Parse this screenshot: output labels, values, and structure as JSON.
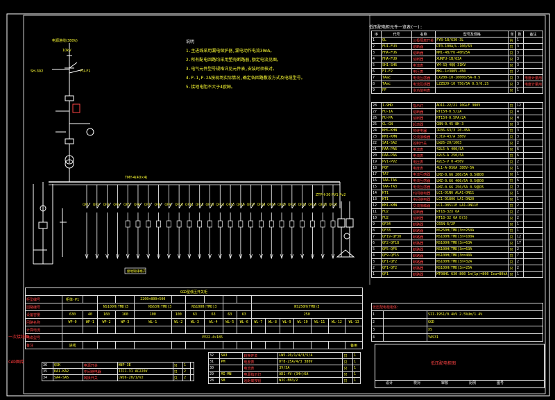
{
  "incoming": {
    "source_label": "电源进线(380V)",
    "voltage": "10kV",
    "switch": "SH-302",
    "fuse_top": "FU-F1",
    "labels": [
      "FH-FU3",
      "TAac",
      "PA",
      "PV",
      "FU3-FU1",
      "PV-PAC",
      "FHA-FU6",
      "HA-FU4",
      "FU-FU6",
      "TH",
      "QF1",
      "CT",
      "GQF1",
      "PM-PAc",
      "MK-1kW",
      "QF1",
      "M-3-7",
      "QF-RL"
    ]
  },
  "bus": {
    "label": "TMY-4(40×4)",
    "right_label": "ZTPH-30 PV1 Pv2",
    "branches": [
      "QF1",
      "QF2",
      "QF3",
      "QF4",
      "QF5",
      "QF6",
      "QF7",
      "QF8",
      "QF9",
      "QF10",
      "QF11",
      "QF12",
      "QF13",
      "QF14",
      "QF15",
      "QF16",
      "QF17",
      "QF18",
      "QF19",
      "QF20",
      "QF21",
      "QF22",
      "QF23",
      "QF24",
      "QF25"
    ],
    "cable_label": "接地铜排端子",
    "aux_labels": [
      "QF33",
      "TA6-TA7",
      "PAN-FHU",
      "SW-TYSN",
      "MLI-IOTB"
    ]
  },
  "notes": {
    "heading": "说明",
    "items": [
      "1.主进线采用漏电保护器,漏电动作电流30mA。",
      "2.所有配电回路均采用塑壳断路器,额定电流见图。",
      "3.电气元件型号规格详见元件表,安装时须核对。",
      "4.P-1,P-2A按现场实际情况,确定各回路敷设方式及电缆型号。",
      "5.接地电阻不大于4欧姆。"
    ]
  },
  "parts": {
    "title": "低压配电柜元件一览表(一):",
    "headers": [
      "序",
      "代号",
      "名称",
      "型号及规格",
      "单",
      "数",
      "备注"
    ],
    "rows": [
      [
        "1",
        "QL",
        "三极隔离开关",
        "FYB-1B/630-3L",
        "台",
        "1",
        ""
      ],
      [
        "2",
        "FU1-FU3",
        "熔断器",
        "RT0-100A/L-100/63",
        "只",
        "3",
        ""
      ],
      [
        "3",
        "FHA-FU6",
        "熔断器",
        "NM1-4B/FU-40H25A",
        "只",
        "3",
        ""
      ],
      [
        "4",
        "FHA-FU9",
        "熔断器",
        "XUNFU-1B/63A",
        "只",
        "3",
        ""
      ],
      [
        "5",
        "SH1-SH6",
        "电流表",
        "YM-SQ-4QQ-31KV",
        "只",
        "3",
        ""
      ],
      [
        "6",
        "F1-F2",
        "电压表",
        "MKL-1×380V-450",
        "只",
        "2",
        ""
      ],
      [
        "7",
        "TAac",
        "电流互感器",
        "LX200-10-10000/5A-0.5",
        "只",
        "3",
        "电度计量用"
      ],
      [
        "8",
        "TAac",
        "电流互感器",
        "LZZBJ9-10 750/5A 0.5/0.2S",
        "只",
        "3",
        "电度计量用"
      ],
      [
        "9",
        "PF",
        "多功能电表",
        "",
        "只",
        "1",
        ""
      ]
    ],
    "rows2": [
      [
        "28",
        "1-9HD",
        "指示灯",
        "AD11-22/21 10GLF 380V",
        "只",
        "12",
        ""
      ],
      [
        "27",
        "FU-1A",
        "熔断器",
        "RT15H-0.5/2A",
        "只",
        "4",
        ""
      ],
      [
        "26",
        "FU-PA",
        "熔断器",
        "RT15H-0.5PA/2A",
        "只",
        "4",
        ""
      ],
      [
        "25",
        "CL-GN",
        "起动器",
        "GBN-0.45-8H-3",
        "只",
        "3",
        ""
      ],
      [
        "24",
        "KHS-KHN",
        "热继电器",
        "JR36-63/3 20-45A",
        "只",
        "3",
        ""
      ],
      [
        "23",
        "KM1-KMN",
        "交流接触器",
        "CJ19-43/A 380V",
        "只",
        "3",
        ""
      ],
      [
        "22",
        "SA1-SA2",
        "控制开关",
        "LW26-20/1003",
        "只",
        "2",
        ""
      ],
      [
        "21",
        "PAA-PA6",
        "电流表",
        "42L5-A 400/5A",
        "只",
        "6",
        ""
      ],
      [
        "20",
        "PAA-PA6",
        "电流表",
        "42L5-A 250/5A",
        "只",
        "6",
        ""
      ],
      [
        "19",
        "PV1-PV2",
        "电压表",
        "42L5-V 0-450V",
        "只",
        "2",
        ""
      ],
      [
        "18",
        "PQF",
        "电度表",
        "4L1-A-DS6A 380V-5A",
        "只",
        "1",
        ""
      ],
      [
        "17",
        "TA7",
        "电流互感器",
        "LMZ-0.66 200/5A 0.5级D0",
        "只",
        "1",
        ""
      ],
      [
        "16",
        "TAA-TA6",
        "电流互感器",
        "LMZ-0.66 400/5A 0.5级D0",
        "只",
        "6",
        ""
      ],
      [
        "15",
        "TAA-TA3",
        "电流互感器",
        "LMZ-0.66 250/5A 0.5级D5",
        "只",
        "3",
        ""
      ],
      [
        "14",
        "KT1",
        "时间继电器",
        "LC1-D1N6 ALA1-DN11",
        "只",
        "1",
        ""
      ],
      [
        "13",
        "KT1",
        "中间继电器",
        "LC1-D1806 LA1-DN20",
        "只",
        "1",
        ""
      ],
      [
        "12",
        "KM1-KMN",
        "交流接触器",
        "LC1-D8511E LA1-DN11E",
        "只",
        "2",
        ""
      ],
      [
        "11",
        "FU2",
        "熔断器",
        "RT18-32X 6A",
        "只",
        "2",
        ""
      ],
      [
        "10",
        "FU2",
        "熔断器",
        "RT18-32 6A D(S)",
        "只",
        "2",
        ""
      ],
      [
        "9",
        "QF34",
        "断路器",
        "C65N-6/2P",
        "只",
        "1",
        ""
      ],
      [
        "8",
        "QF33",
        "断路器",
        "NS250H(TMD)3n=250A",
        "只",
        "1",
        ""
      ],
      [
        "7",
        "QF19-QF30",
        "断路器",
        "NS100H(TMD)3n=100A",
        "只",
        "12",
        ""
      ],
      [
        "6",
        "QF2-QF18",
        "断路器",
        "NS100H(TMD)3n=63A",
        "只",
        "17",
        ""
      ],
      [
        "5",
        "QF5-QF6",
        "断路器",
        "NS100H(TMD)3n=63A",
        "只",
        "2",
        ""
      ],
      [
        "4",
        "QF9-QF15",
        "断路器",
        "NS100H(TMD)3n=40A",
        "只",
        "7",
        ""
      ],
      [
        "3",
        "QF1-QF2",
        "断路器",
        "NS100H(TMD)3n=32A",
        "只",
        "2",
        ""
      ],
      [
        "2",
        "QF1-QF2",
        "断路器",
        "NS100H(TMD)3n=25A",
        "只",
        "2",
        ""
      ],
      [
        "1",
        "QF1",
        "断路器",
        "MT08H1 630-800 1n(1p)=800 Icu=80kA",
        "只",
        "1",
        ""
      ]
    ]
  },
  "summary": {
    "title": "低压配电柜柜体:",
    "rows": [
      [
        "1",
        "",
        "SII-1951/0.4kV 2.5%Um/1.4%"
      ],
      [
        "2",
        "",
        "GGD"
      ],
      [
        "3",
        "",
        "XS"
      ],
      [
        "4",
        "",
        "YAS31"
      ]
    ]
  },
  "circuit_table": {
    "header": "GGD型低压开关柜",
    "rows": [
      {
        "label": "柜型编号",
        "vals": [
          "柜体-P1",
          "",
          "",
          "",
          "2200×800×500",
          "",
          "",
          "",
          "",
          "",
          ""
        ]
      },
      {
        "label": "回路编号",
        "vals": [
          "",
          "NS100H(TMD)3",
          "NS63H(TMD)3",
          "NS100H(TMD)3",
          "",
          "NS250H(TMD)3"
        ]
      },
      {
        "label": "设备容量",
        "vals": [
          "630",
          "40",
          "160",
          "160",
          "100",
          "100",
          "63",
          "63",
          "63",
          "63",
          "250"
        ]
      },
      {
        "label": "回路名称",
        "vals": [
          "WP-0",
          "WP-1",
          "WP-2",
          "WP-3",
          "WL-1",
          "WL-2",
          "WL-3",
          "WL-4",
          "WL-5",
          "WL-6",
          "WL-7",
          "WL-8",
          "WL-9",
          "WL-10",
          "WL-11",
          "WL-12",
          "WL-13"
        ]
      },
      {
        "label": "计算电流",
        "vals": [
          "",
          "",
          "",
          "",
          "",
          "",
          "",
          "",
          "",
          "",
          "",
          "",
          "",
          "",
          "",
          "",
          ""
        ]
      },
      {
        "label": "电缆型号",
        "vals": [
          "VV22-4×185"
        ]
      },
      {
        "label": "备注",
        "vals": [
          "进线",
          "",
          "",
          "",
          "",
          "",
          "",
          "",
          "",
          "",
          "",
          "",
          "",
          "",
          "",
          "",
          "备用"
        ]
      }
    ]
  },
  "bottom_parts": {
    "rows": [
      [
        "36",
        "QSK",
        "电源开关",
        "HNP-3E",
        "只",
        "1",
        ""
      ],
      [
        "35",
        "KA1-KA2",
        "中间继电器",
        "JZC1-31 AC220V",
        "只",
        "2",
        ""
      ],
      [
        "34",
        "SA4-SA5",
        "转换开关",
        "LW26-20/1/V2",
        "只",
        "2",
        ""
      ]
    ],
    "rows2": [
      [
        "32",
        "SA3",
        "转换开关",
        "LW5-20/1/4/3/5/4",
        "只",
        "1"
      ],
      [
        "31",
        "PM",
        "电度表",
        "DT8-25A/4/3 380V",
        "只",
        "1"
      ],
      [
        "30",
        "",
        "电流表",
        "3V/5A",
        "只",
        "1"
      ],
      [
        "29",
        "MI-MN",
        "电源指示灯",
        "AD1-4V-(34+)6A",
        "只",
        "1"
      ],
      [
        "28",
        "SB",
        "远距离按钮",
        "WJC-EN3/2",
        "只",
        "1"
      ]
    ]
  },
  "title_block": {
    "title": "低压配电柜图",
    "cells": [
      "设计",
      "校对",
      "审核",
      "比例",
      "图号"
    ]
  },
  "side_tags": [
    "一次接线图",
    "CAD图库"
  ]
}
